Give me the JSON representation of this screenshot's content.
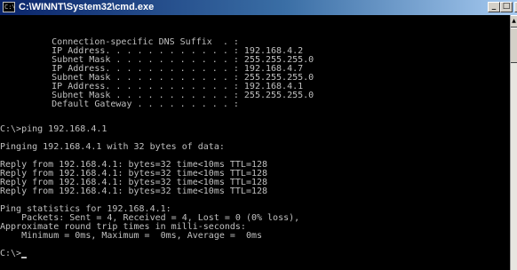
{
  "window": {
    "title": "C:\\WINNT\\System32\\cmd.exe",
    "system_icon": "cmd-icon",
    "icon_glyph": "C:\\",
    "minimize_glyph": "_",
    "maximize_glyph": "□",
    "close_glyph": "x"
  },
  "console": {
    "lines": [
      "        Connection-specific DNS Suffix  . :",
      "        IP Address. . . . . . . . . . . . : 192.168.4.2",
      "        Subnet Mask . . . . . . . . . . . : 255.255.255.0",
      "        IP Address. . . . . . . . . . . . : 192.168.4.7",
      "        Subnet Mask . . . . . . . . . . . : 255.255.255.0",
      "        IP Address. . . . . . . . . . . . : 192.168.4.1",
      "        Subnet Mask . . . . . . . . . . . : 255.255.255.0",
      "        Default Gateway . . . . . . . . . :",
      "C:\\>ping 192.168.4.1",
      "Pinging 192.168.4.1 with 32 bytes of data:",
      "Reply from 192.168.4.1: bytes=32 time<10ms TTL=128",
      "Reply from 192.168.4.1: bytes=32 time<10ms TTL=128",
      "Reply from 192.168.4.1: bytes=32 time<10ms TTL=128",
      "Reply from 192.168.4.1: bytes=32 time<10ms TTL=128",
      "Ping statistics for 192.168.4.1:",
      "    Packets: Sent = 4, Received = 4, Lost = 0 (0% loss),",
      "Approximate round trip times in milli-seconds:",
      "    Minimum = 0ms, Maximum =  0ms, Average =  0ms",
      "C:\\>"
    ]
  },
  "scrollbar": {
    "up_glyph": "▲"
  },
  "colors": {
    "console_text": "#c0c0c0",
    "console_background": "#000000",
    "titlebar_start": "#0a246a",
    "titlebar_end": "#a6caf0"
  }
}
